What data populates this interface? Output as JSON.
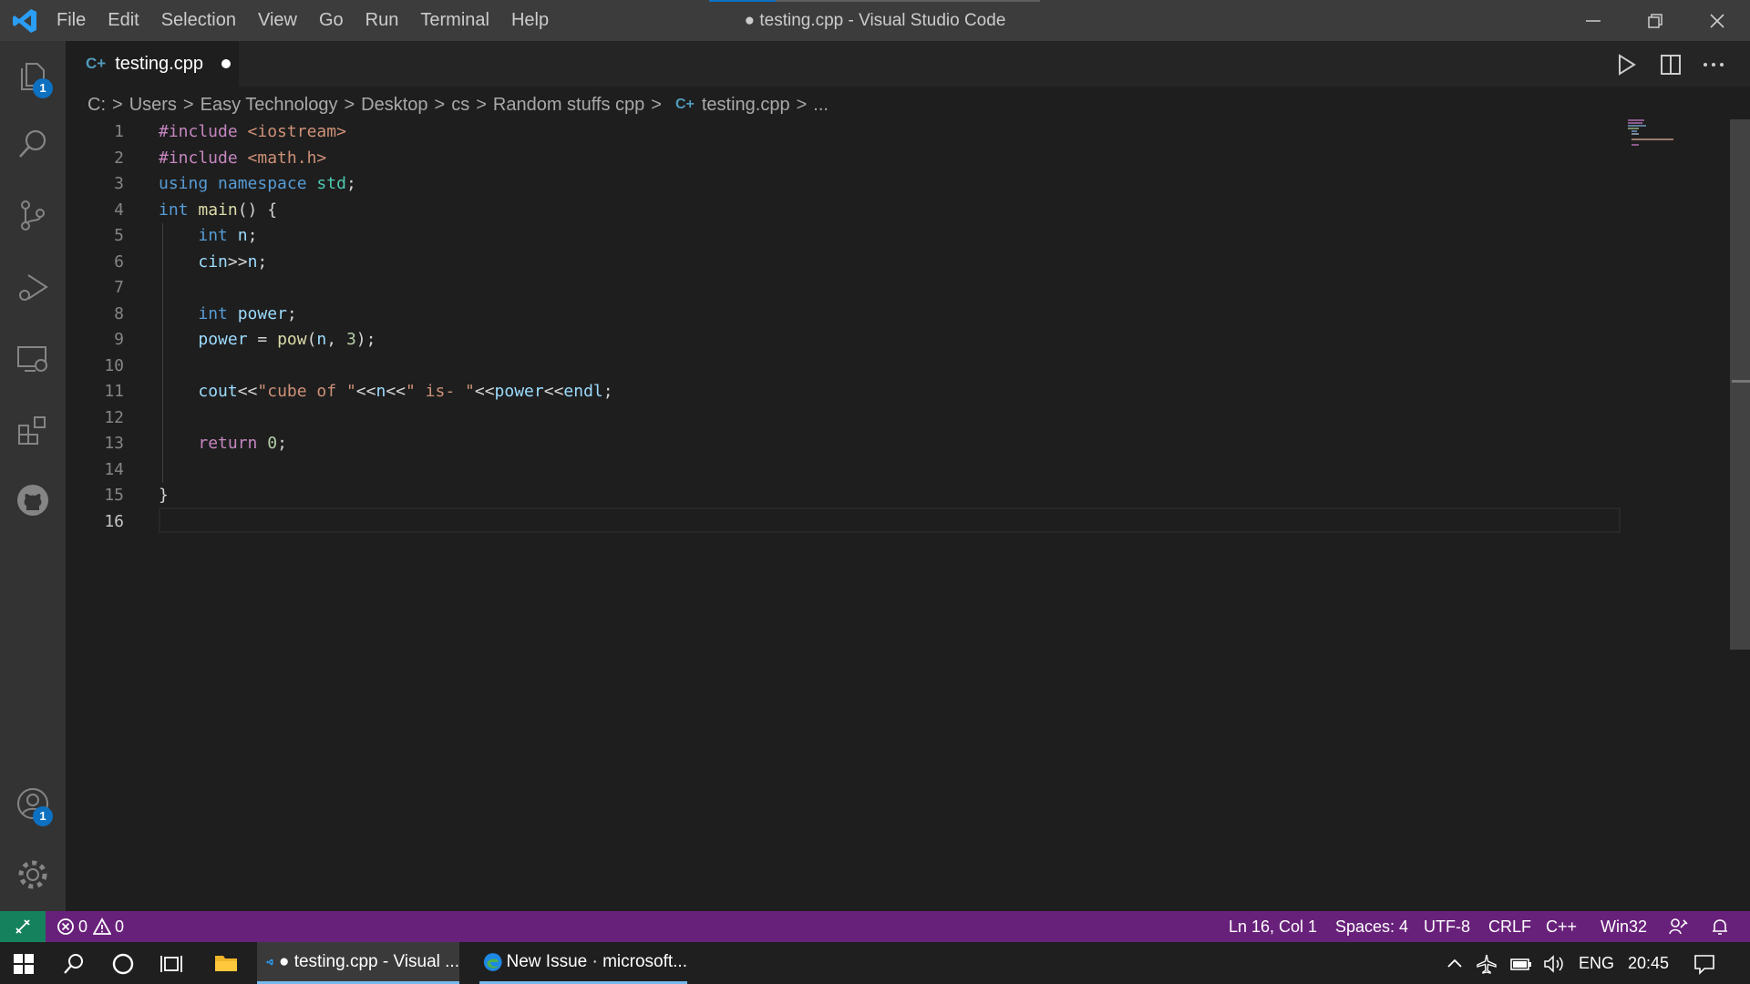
{
  "window": {
    "title": "● testing.cpp - Visual Studio Code",
    "menu": [
      "File",
      "Edit",
      "Selection",
      "View",
      "Go",
      "Run",
      "Terminal",
      "Help"
    ]
  },
  "activity": {
    "explorer_badge": "1",
    "accounts_badge": "1"
  },
  "tab": {
    "label": "testing.cpp",
    "icon_glyph": "C+"
  },
  "breadcrumb": [
    "C:",
    "Users",
    "Easy Technology",
    "Desktop",
    "cs",
    "Random stuffs cpp",
    "testing.cpp",
    "..."
  ],
  "editor": {
    "line_numbers": [
      "1",
      "2",
      "3",
      "4",
      "5",
      "6",
      "7",
      "8",
      "9",
      "10",
      "11",
      "12",
      "13",
      "14",
      "15",
      "16"
    ],
    "active_line": "16"
  },
  "statusbar": {
    "errors": "0",
    "warnings": "0",
    "position": "Ln 16, Col 1",
    "spaces": "Spaces: 4",
    "encoding": "UTF-8",
    "eol": "CRLF",
    "language": "C++",
    "platform": "Win32"
  },
  "taskbar": {
    "vscode_label": "● testing.cpp - Visual ...",
    "edge_label": "New Issue · microsoft...",
    "language": "ENG",
    "time": "20:45"
  },
  "colors": {
    "statusbar": "#68217a",
    "remote": "#16825d",
    "accent": "#0e70c0"
  }
}
